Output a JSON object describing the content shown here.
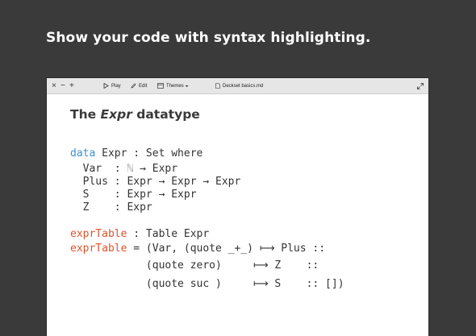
{
  "headline": "Show your code with syntax highlighting.",
  "window": {
    "controls": {
      "close": "×",
      "minimize": "−",
      "maximize": "+"
    },
    "toolbar": {
      "play_label": "Play",
      "edit_label": "Edit",
      "themes_label": "Themes",
      "document_name": "Deckset basics.md"
    }
  },
  "slide": {
    "title_prefix": "The ",
    "title_emphasis": "Expr",
    "title_suffix": " datatype",
    "code": {
      "l1_kw": "data",
      "l1_rest": " Expr : Set where",
      "l2_pre": "  Var  : ",
      "l2_nat": "ℕ",
      "l2_post": " → Expr",
      "l3": "  Plus : Expr → Expr → Expr",
      "l4": "  S    : Expr → Expr",
      "l5": "  Z    : Expr",
      "l6_fn": "exprTable",
      "l6_rest": " : Table Expr",
      "l7_fn": "exprTable",
      "l7_rest": " = (Var, (quote _+_) ⟼ Plus ::",
      "l8": "            (quote zero)     ⟼ Z    ::",
      "l9": "            (quote suc )     ⟼ S    :: [])"
    }
  },
  "colors": {
    "background": "#3a3a3a",
    "keyword": "#3a8fd6",
    "function_name": "#e0522a",
    "natural_symbol": "#9a9a9a"
  }
}
